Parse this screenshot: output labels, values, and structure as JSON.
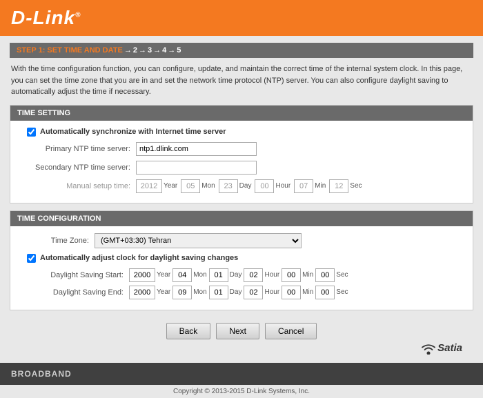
{
  "header": {
    "logo_text": "D-Link",
    "logo_dot": "®"
  },
  "step_bar": {
    "step1": "STEP 1: SET TIME AND DATE",
    "arrow1": "→",
    "step2": "2",
    "arrow2": "→",
    "step3": "3",
    "arrow3": "→",
    "step4": "4",
    "arrow4": "→",
    "step5": "5"
  },
  "description": "With the time configuration function, you can configure, update, and maintain the correct time of the internal system clock. In this page, you can set the time zone that you are in and set the network time protocol (NTP) server. You can also configure daylight saving to automatically adjust the time if necessary.",
  "time_setting": {
    "section_title": "TIME SETTING",
    "auto_sync_label": "Automatically synchronize with Internet time server",
    "auto_sync_checked": true,
    "primary_label": "Primary NTP time server:",
    "primary_value": "ntp1.dlink.com",
    "secondary_label": "Secondary NTP time server:",
    "secondary_value": "",
    "manual_label": "Manual setup time:",
    "manual_year": "2012",
    "manual_year_label": "Year",
    "manual_mon": "05",
    "manual_mon_label": "Mon",
    "manual_day": "23",
    "manual_day_label": "Day",
    "manual_hour": "00",
    "manual_hour_label": "Hour",
    "manual_min": "07",
    "manual_min_label": "Min",
    "manual_sec": "12",
    "manual_sec_label": "Sec"
  },
  "time_configuration": {
    "section_title": "TIME CONFIGURATION",
    "timezone_label": "Time Zone:",
    "timezone_value": "(GMT+03:30) Tehran",
    "timezone_options": [
      "(GMT+03:30) Tehran"
    ],
    "auto_dst_label": "Automatically adjust clock for daylight saving changes",
    "auto_dst_checked": true,
    "dst_start_label": "Daylight Saving Start:",
    "dst_start_year": "2000",
    "dst_start_year_label": "Year",
    "dst_start_mon": "04",
    "dst_start_mon_label": "Mon",
    "dst_start_day": "01",
    "dst_start_day_label": "Day",
    "dst_start_hour": "02",
    "dst_start_hour_label": "Hour",
    "dst_start_min": "00",
    "dst_start_min_label": "Min",
    "dst_start_sec": "00",
    "dst_start_sec_label": "Sec",
    "dst_end_label": "Daylight Saving End:",
    "dst_end_year": "2000",
    "dst_end_year_label": "Year",
    "dst_end_mon": "09",
    "dst_end_mon_label": "Mon",
    "dst_end_day": "01",
    "dst_end_day_label": "Day",
    "dst_end_hour": "02",
    "dst_end_hour_label": "Hour",
    "dst_end_min": "00",
    "dst_end_min_label": "Min",
    "dst_end_sec": "00",
    "dst_end_sec_label": "Sec"
  },
  "buttons": {
    "back": "Back",
    "next": "Next",
    "cancel": "Cancel"
  },
  "footer": {
    "label": "BROADBAND"
  },
  "copyright": "Copyright © 2013-2015 D-Link Systems, Inc.",
  "satia": {
    "text": "Satia"
  }
}
